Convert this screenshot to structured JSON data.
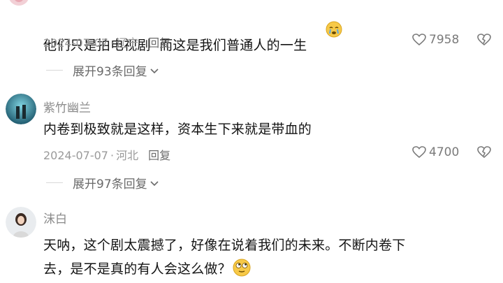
{
  "comments": [
    {
      "username": "",
      "text": "他们只是拍电视剧  而这是我们普通人的一生",
      "emoji": "crying-face-emoji",
      "date": "2024-07-07",
      "location": "辽宁",
      "reply_label": "回复",
      "likes": "7958",
      "expand_label": "展开93条回复"
    },
    {
      "username": "紫竹幽兰",
      "text": "内卷到极致就是这样，资本生下来就是带血的",
      "date": "2024-07-07",
      "location": "河北",
      "reply_label": "回复",
      "likes": "4700",
      "expand_label": "展开97条回复"
    },
    {
      "username": "沫白",
      "text_line1": "天呐，这个剧太震撼了，好像在说着我们的未来。不断内卷下",
      "text_line2": "去，是不是真的有人会这么做？",
      "emoji": "rolling-eyes-emoji"
    }
  ],
  "colors": {
    "meta": "#9a9a9a",
    "username": "#8a8a8a",
    "text": "#141414"
  }
}
